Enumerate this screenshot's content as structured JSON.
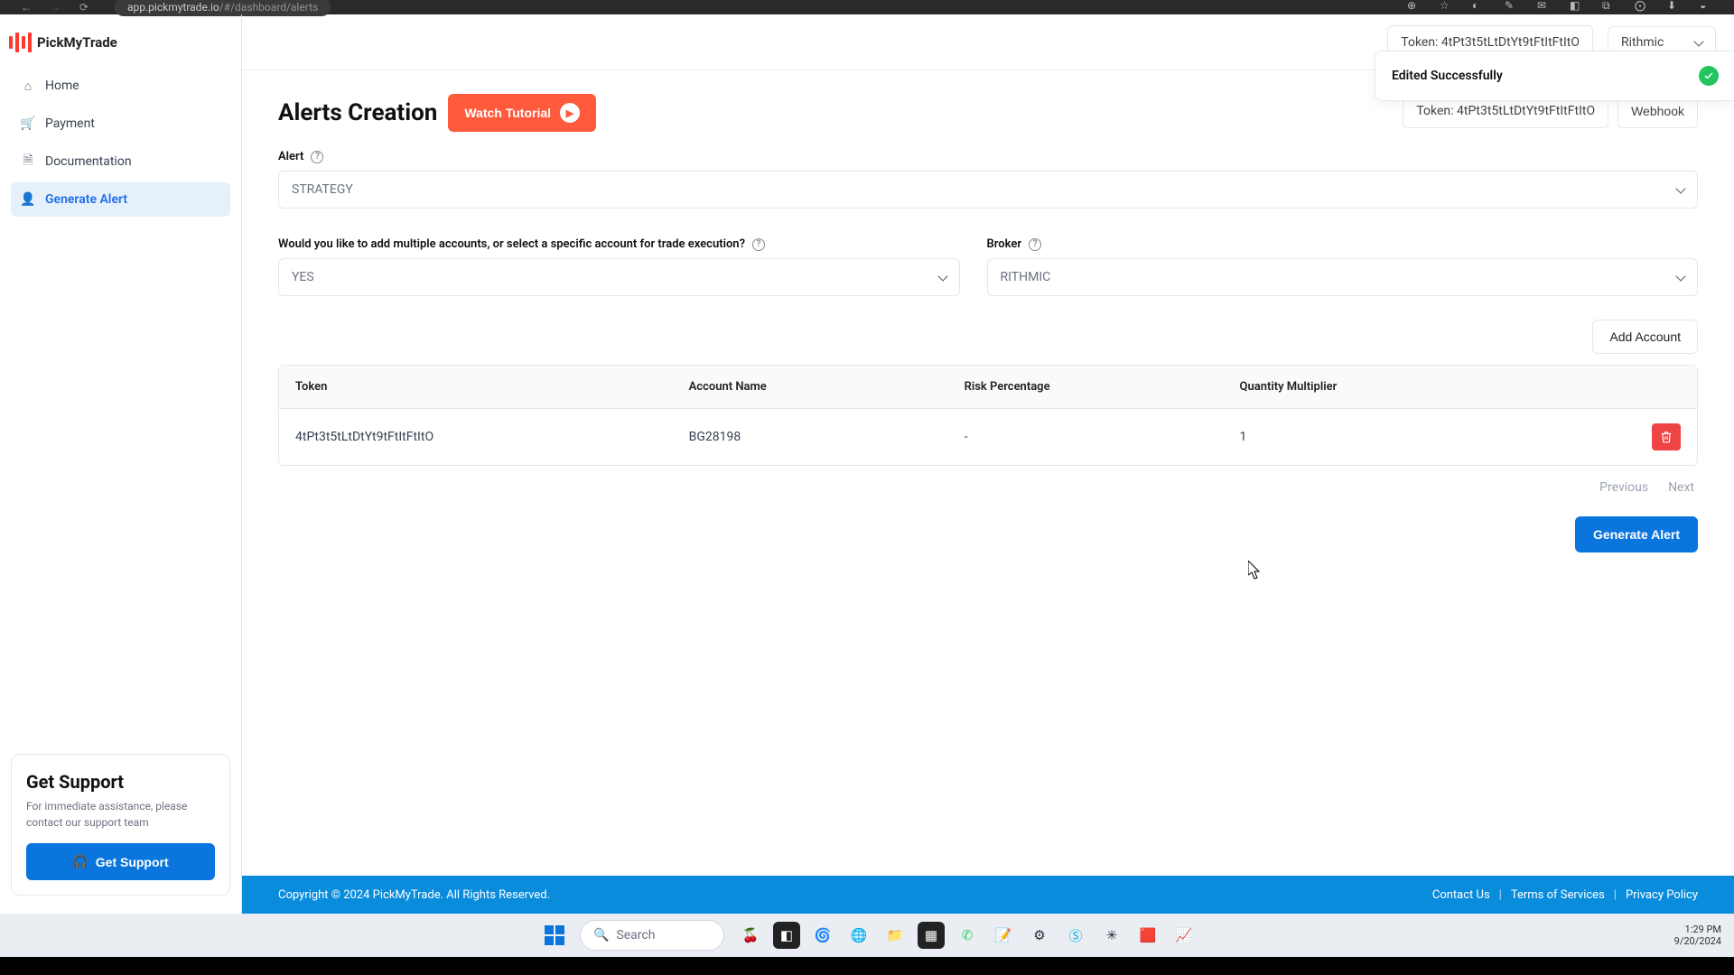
{
  "browser": {
    "url_host": "app.pickmytrade.io",
    "url_path": "/#/dashboard/alerts"
  },
  "brand": {
    "name": "PickMyTrade"
  },
  "sidebar": {
    "items": [
      {
        "label": "Home"
      },
      {
        "label": "Payment"
      },
      {
        "label": "Documentation"
      },
      {
        "label": "Generate Alert"
      }
    ],
    "support": {
      "title": "Get Support",
      "desc": "For immediate assistance, please contact our support team",
      "button": "Get Support"
    }
  },
  "topbar": {
    "token_prefix": "Token: ",
    "token": "4tPt3t5tLtDtYt9tFtItFtItO",
    "broker_select": "Rithmic"
  },
  "toast": {
    "text": "Edited Successfully"
  },
  "page": {
    "title": "Alerts Creation",
    "tutorial": "Watch Tutorial",
    "token_pill_prefix": "Token: ",
    "token_pill_value": "4tPt3t5tLtDtYt9tFtItFtItO",
    "webhook_btn": "Webhook"
  },
  "form": {
    "alert_label": "Alert",
    "alert_value": "STRATEGY",
    "multi_label": "Would you like to add multiple accounts, or select a specific account for trade execution?",
    "multi_value": "YES",
    "broker_label": "Broker",
    "broker_value": "RITHMIC"
  },
  "accounts": {
    "add_btn": "Add Account",
    "headers": [
      "Token",
      "Account Name",
      "Risk Percentage",
      "Quantity Multiplier"
    ],
    "rows": [
      {
        "token": "4tPt3t5tLtDtYt9tFtItFtItO",
        "account": "BG28198",
        "risk": "-",
        "qty": "1"
      }
    ]
  },
  "pager": {
    "prev": "Previous",
    "next": "Next"
  },
  "generate_btn": "Generate Alert",
  "footer": {
    "copyright": "Copyright © 2024 PickMyTrade. All Rights Reserved.",
    "links": [
      "Contact Us",
      "Terms of Services",
      "Privacy Policy"
    ]
  },
  "taskbar": {
    "search": "Search",
    "time": "1:29 PM",
    "date": "9/20/2024"
  }
}
